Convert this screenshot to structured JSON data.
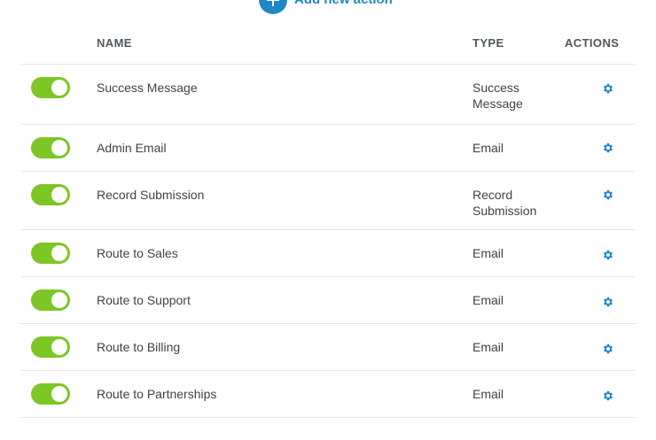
{
  "header": {
    "add_label": "Add new action"
  },
  "columns": {
    "name": "NAME",
    "type": "TYPE",
    "actions": "ACTIONS"
  },
  "colors": {
    "accent": "#1e88c7",
    "toggle_on": "#7cc626"
  },
  "rows": [
    {
      "name": "Success Message",
      "type_lines": [
        "Success",
        "Message"
      ],
      "enabled": true
    },
    {
      "name": "Admin Email",
      "type_lines": [
        "Email"
      ],
      "enabled": true
    },
    {
      "name": "Record Submission",
      "type_lines": [
        "Record",
        "Submission"
      ],
      "enabled": true
    },
    {
      "name": "Route to Sales",
      "type_lines": [
        "Email"
      ],
      "enabled": true
    },
    {
      "name": "Route to Support",
      "type_lines": [
        "Email"
      ],
      "enabled": true
    },
    {
      "name": "Route to Billing",
      "type_lines": [
        "Email"
      ],
      "enabled": true
    },
    {
      "name": "Route to Partnerships",
      "type_lines": [
        "Email"
      ],
      "enabled": true
    }
  ]
}
